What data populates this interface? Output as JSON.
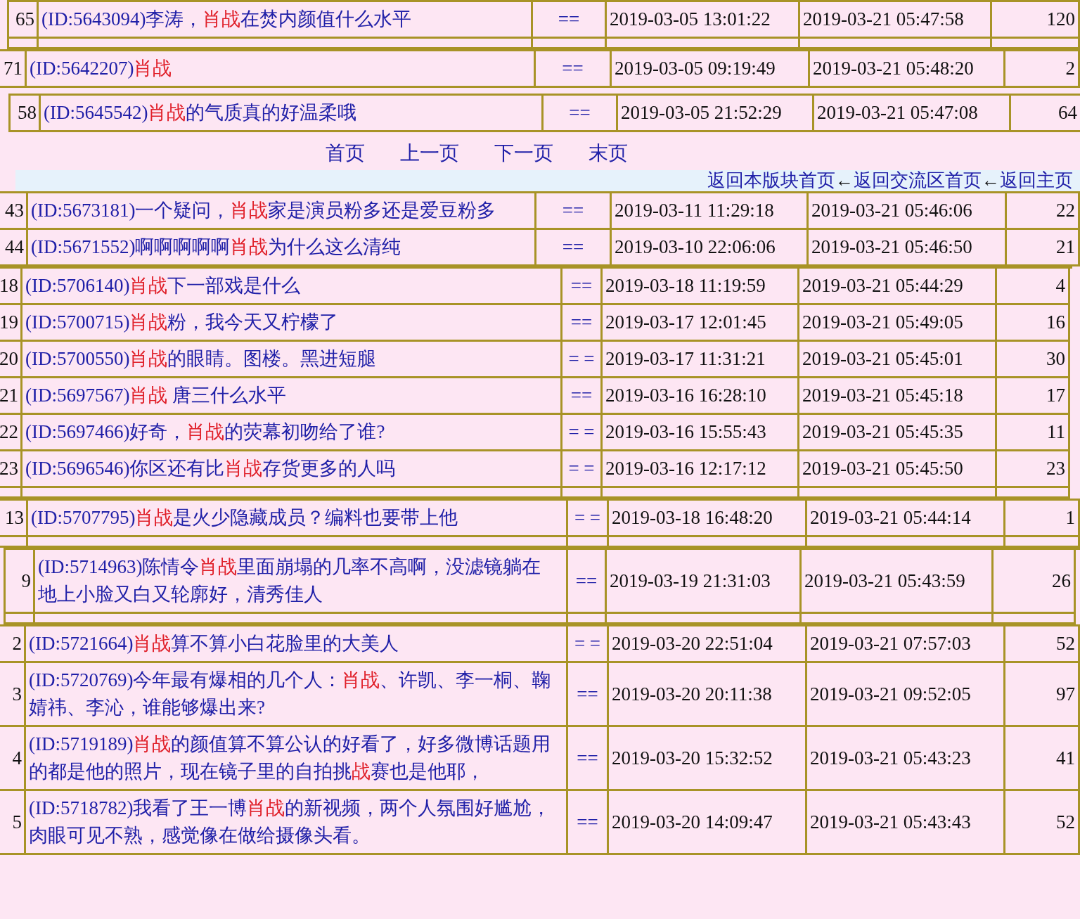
{
  "fragments": [
    {
      "kind": "table",
      "rows": [
        {
          "kind": "row",
          "number": "65",
          "title": [
            {
              "text": "(ID:5643094)李涛，",
              "highlight": false
            },
            {
              "text": "肖战",
              "highlight": true
            },
            {
              "text": "在焚内颜值什么水平",
              "highlight": false
            }
          ],
          "mark": "==",
          "created": "2019-03-05 13:01:22",
          "replied": "2019-03-21 05:47:58",
          "count": "120"
        },
        {
          "kind": "stub"
        }
      ]
    },
    {
      "kind": "table",
      "rows": [
        {
          "kind": "row",
          "number": "71",
          "title": [
            {
              "text": "(ID:5642207)",
              "highlight": false
            },
            {
              "text": "肖战",
              "highlight": true
            }
          ],
          "mark": "==",
          "created": "2019-03-05 09:19:49",
          "replied": "2019-03-21 05:48:20",
          "count": "2"
        }
      ]
    },
    {
      "kind": "table",
      "rows": [
        {
          "kind": "row",
          "number": "58",
          "title": [
            {
              "text": "(ID:5645542)",
              "highlight": false
            },
            {
              "text": "肖战",
              "highlight": true
            },
            {
              "text": "的气质真的好温柔哦",
              "highlight": false
            }
          ],
          "mark": "==",
          "created": "2019-03-05 21:52:29",
          "replied": "2019-03-21 05:47:08",
          "count": "64"
        }
      ]
    },
    {
      "kind": "nav",
      "pages": [
        "首页",
        "上一页",
        "下一页",
        "末页"
      ],
      "breadcrumbs": [
        {
          "kind": "link",
          "text": "返回本版块首页"
        },
        {
          "kind": "arrow",
          "text": "←"
        },
        {
          "kind": "link",
          "text": "返回交流区首页"
        },
        {
          "kind": "arrow",
          "text": "←"
        },
        {
          "kind": "link",
          "text": "返回主页"
        }
      ]
    },
    {
      "kind": "table",
      "rows": [
        {
          "kind": "row",
          "number": "43",
          "title": [
            {
              "text": "(ID:5673181)一个疑问，",
              "highlight": false
            },
            {
              "text": "肖战",
              "highlight": true
            },
            {
              "text": "家是演员粉多还是爱豆粉多",
              "highlight": false
            }
          ],
          "mark": "==",
          "created": "2019-03-11 11:29:18",
          "replied": "2019-03-21 05:46:06",
          "count": "22"
        },
        {
          "kind": "row",
          "number": "44",
          "title": [
            {
              "text": "(ID:5671552)啊啊啊啊啊",
              "highlight": false
            },
            {
              "text": "肖战",
              "highlight": true
            },
            {
              "text": "为什么这么清纯",
              "highlight": false
            }
          ],
          "mark": "==",
          "created": "2019-03-10 22:06:06",
          "replied": "2019-03-21 05:46:50",
          "count": "21"
        }
      ]
    },
    {
      "kind": "table",
      "rows": [
        {
          "kind": "row",
          "number": "18",
          "title": [
            {
              "text": "(ID:5706140)",
              "highlight": false
            },
            {
              "text": "肖战",
              "highlight": true
            },
            {
              "text": "下一部戏是什么",
              "highlight": false
            }
          ],
          "mark": "==",
          "created": "2019-03-18 11:19:59",
          "replied": "2019-03-21 05:44:29",
          "count": "4"
        },
        {
          "kind": "row",
          "number": "19",
          "title": [
            {
              "text": "(ID:5700715)",
              "highlight": false
            },
            {
              "text": "肖战",
              "highlight": true
            },
            {
              "text": "粉，我今天又柠檬了",
              "highlight": false
            }
          ],
          "mark": "==",
          "created": "2019-03-17 12:01:45",
          "replied": "2019-03-21 05:49:05",
          "count": "16"
        },
        {
          "kind": "row",
          "number": "20",
          "title": [
            {
              "text": "(ID:5700550)",
              "highlight": false
            },
            {
              "text": "肖战",
              "highlight": true
            },
            {
              "text": "的眼睛。图楼。黑进短腿",
              "highlight": false
            }
          ],
          "mark": "= =",
          "created": "2019-03-17 11:31:21",
          "replied": "2019-03-21 05:45:01",
          "count": "30"
        },
        {
          "kind": "row",
          "number": "21",
          "title": [
            {
              "text": "(ID:5697567)",
              "highlight": false
            },
            {
              "text": "肖战",
              "highlight": true
            },
            {
              "text": " 唐三什么水平",
              "highlight": false
            }
          ],
          "mark": "==",
          "created": "2019-03-16 16:28:10",
          "replied": "2019-03-21 05:45:18",
          "count": "17"
        },
        {
          "kind": "row",
          "number": "22",
          "title": [
            {
              "text": "(ID:5697466)好奇，",
              "highlight": false
            },
            {
              "text": "肖战",
              "highlight": true
            },
            {
              "text": "的荧幕初吻给了谁?",
              "highlight": false
            }
          ],
          "mark": "= =",
          "created": "2019-03-16 15:55:43",
          "replied": "2019-03-21 05:45:35",
          "count": "11"
        },
        {
          "kind": "row",
          "number": "23",
          "title": [
            {
              "text": "(ID:5696546)你区还有比",
              "highlight": false
            },
            {
              "text": "肖战",
              "highlight": true
            },
            {
              "text": "存货更多的人吗",
              "highlight": false
            }
          ],
          "mark": "= =",
          "created": "2019-03-16 12:17:12",
          "replied": "2019-03-21 05:45:50",
          "count": "23"
        },
        {
          "kind": "stub"
        }
      ]
    },
    {
      "kind": "table",
      "rows": [
        {
          "kind": "row",
          "number": "13",
          "title": [
            {
              "text": "(ID:5707795)",
              "highlight": false
            },
            {
              "text": "肖战",
              "highlight": true
            },
            {
              "text": "是火少隐藏成员？编料也要带上他",
              "highlight": false
            }
          ],
          "mark": "= =",
          "created": "2019-03-18 16:48:20",
          "replied": "2019-03-21 05:44:14",
          "count": "1"
        },
        {
          "kind": "stub"
        }
      ]
    },
    {
      "kind": "table",
      "rows": [
        {
          "kind": "row",
          "number": "9",
          "title": [
            {
              "text": "(ID:5714963)陈情令",
              "highlight": false
            },
            {
              "text": "肖战",
              "highlight": true
            },
            {
              "text": "里面崩塌的几率不高啊，没滤镜躺在地上小脸又白又轮廓好，清秀佳人",
              "highlight": false
            }
          ],
          "mark": "==",
          "created": "2019-03-19 21:31:03",
          "replied": "2019-03-21 05:43:59",
          "count": "26"
        },
        {
          "kind": "stub"
        }
      ]
    },
    {
      "kind": "table",
      "rows": [
        {
          "kind": "row",
          "number": "2",
          "title": [
            {
              "text": "(ID:5721664)",
              "highlight": false
            },
            {
              "text": "肖战",
              "highlight": true
            },
            {
              "text": "算不算小白花脸里的大美人",
              "highlight": false
            }
          ],
          "mark": "= =",
          "created": "2019-03-20 22:51:04",
          "replied": "2019-03-21 07:57:03",
          "count": "52"
        },
        {
          "kind": "row",
          "number": "3",
          "title": [
            {
              "text": "(ID:5720769)今年最有爆相的几个人：",
              "highlight": false
            },
            {
              "text": "肖战",
              "highlight": true
            },
            {
              "text": "、许凯、李一桐、鞠婧祎、李沁，谁能够爆出来?",
              "highlight": false
            }
          ],
          "mark": "==",
          "created": "2019-03-20 20:11:38",
          "replied": "2019-03-21 09:52:05",
          "count": "97"
        },
        {
          "kind": "row",
          "number": "4",
          "title": [
            {
              "text": "(ID:5719189)",
              "highlight": false
            },
            {
              "text": "肖战",
              "highlight": true
            },
            {
              "text": "的颜值算不算公认的好看了，好多微博话题用的都是他的照片，现在镜子里的自拍挑",
              "highlight": false
            },
            {
              "text": "战",
              "highlight": true
            },
            {
              "text": "赛也是他耶，",
              "highlight": false
            }
          ],
          "mark": "==",
          "created": "2019-03-20 15:32:52",
          "replied": "2019-03-21 05:43:23",
          "count": "41"
        },
        {
          "kind": "row",
          "number": "5",
          "title": [
            {
              "text": "(ID:5718782)我看了王一博",
              "highlight": false
            },
            {
              "text": "肖战",
              "highlight": true
            },
            {
              "text": "的新视频，两个人氛围好尴尬，肉眼可见不熟，感觉像在做给摄像头看。",
              "highlight": false
            }
          ],
          "mark": "==",
          "created": "2019-03-20 14:09:47",
          "replied": "2019-03-21 05:43:43",
          "count": "52"
        }
      ]
    }
  ]
}
